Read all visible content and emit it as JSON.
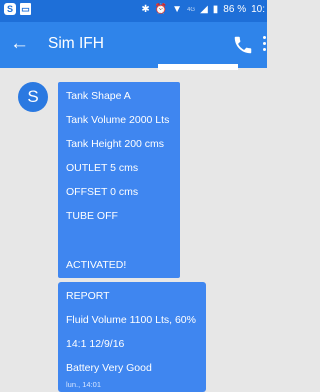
{
  "status_bar": {
    "time": "10:",
    "battery_percent": "86 %",
    "network": "4G"
  },
  "app_bar": {
    "title": "Sim IFH"
  },
  "conversation": {
    "avatar_letter": "S",
    "bubble1_lines": [
      "Tank Shape A",
      "Tank Volume 2000 Lts",
      "Tank Height 200 cms",
      "OUTLET 5 cms",
      "OFFSET 0 cms",
      "TUBE OFF",
      "ACTIVATED!"
    ],
    "bubble2_lines": [
      "REPORT",
      "Fluid Volume 1100 Lts, 60%",
      "14:1 12/9/16",
      "Battery  Very Good"
    ],
    "bubble2_time": "lun., 14:01"
  }
}
